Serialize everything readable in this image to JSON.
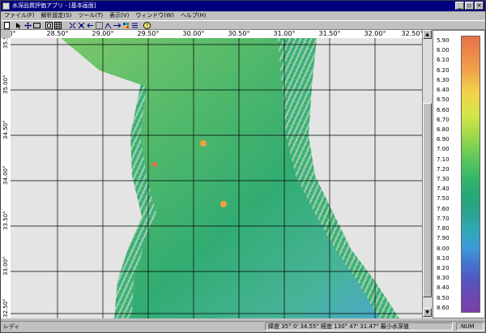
{
  "window": {
    "title": "水深品質評価アプリ - [基本画面]"
  },
  "titlebar_buttons": {
    "minimize": "_",
    "restore": "▫",
    "close": "×"
  },
  "menu": [
    "ファイル(F)",
    "解析設定(S)",
    "ツール(T)",
    "表示(V)",
    "ウィンドウ(W)",
    "ヘルプ(H)"
  ],
  "toolbar": {
    "icons": [
      "new-icon",
      "pointer-icon",
      "pan-icon",
      "rect-select-icon",
      "zoom-fit-icon",
      "grid-icon",
      "zoom-in-icon",
      "zoom-out-icon",
      "zoom-prev-icon",
      "measure-icon",
      "sample-icon",
      "layer-icon",
      "color-icon",
      "list-icon",
      "help-icon"
    ]
  },
  "xaxis": {
    "labels": [
      "0°",
      "28.50°",
      "29.00°",
      "29.50°",
      "30.00°",
      "30.50°",
      "31.00°",
      "31.50°",
      "32.00°",
      "32.50°"
    ]
  },
  "yaxis": {
    "labels": [
      "35.50°",
      "35.00°",
      "34.50°",
      "34.00°",
      "33.50°",
      "33.00°",
      "32.50°"
    ]
  },
  "legend": {
    "values": [
      "5.90",
      "6.00",
      "6.10",
      "6.20",
      "6.30",
      "6.40",
      "6.50",
      "6.60",
      "6.70",
      "6.80",
      "6.90",
      "7.00",
      "7.10",
      "7.20",
      "7.30",
      "7.40",
      "7.50",
      "7.60",
      "7.70",
      "7.80",
      "7.90",
      "8.00",
      "8.10",
      "8.20",
      "8.30",
      "8.40",
      "8.50",
      "8.60"
    ],
    "scale_colors": [
      "#e8714a",
      "#f2d04a",
      "#9ed84a",
      "#32b56a",
      "#30a8b4",
      "#4478d0",
      "#7a40a8"
    ]
  },
  "status": {
    "ready": "レディ",
    "coord": "緯度 35° 0' 34.55\"  経度 130° 47' 31.47\"  最小水深値",
    "num": "NUM"
  }
}
